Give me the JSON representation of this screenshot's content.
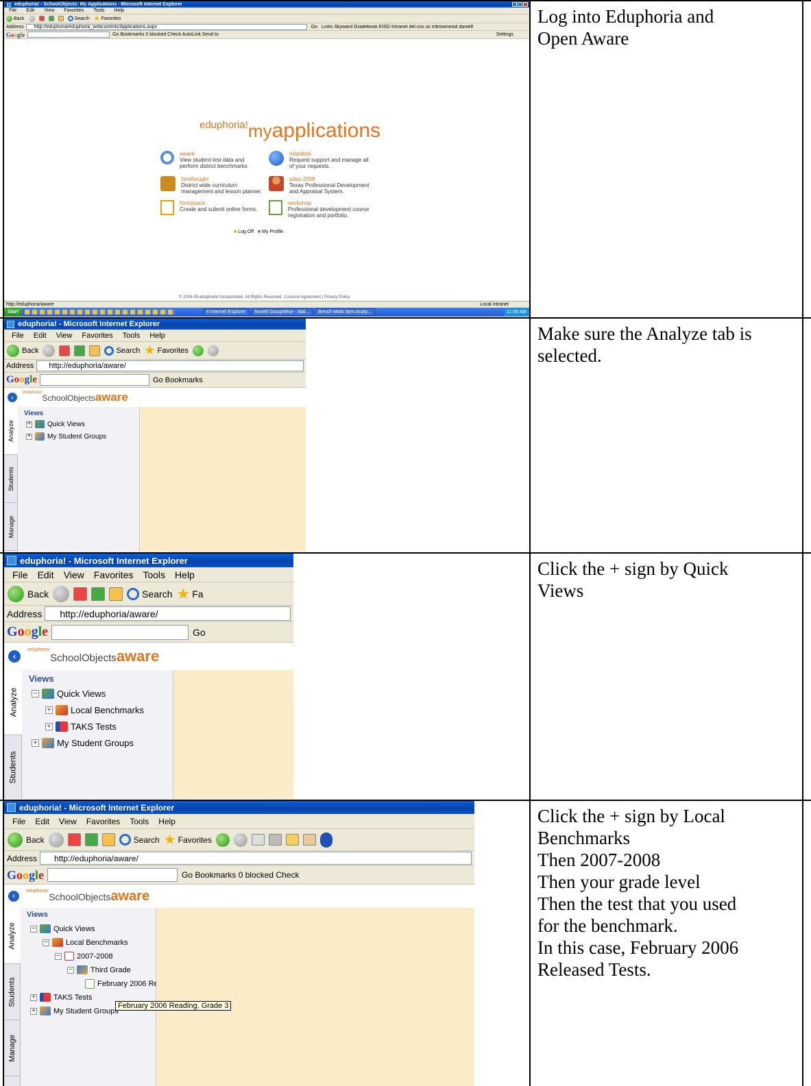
{
  "rows": [
    {
      "instruction_lines": [
        "Log into Eduphoria and",
        "Open Aware"
      ],
      "browser": {
        "title": "eduphoria! - SchoolObjects: My Applications - Microsoft Internet Explorer",
        "menu": [
          "File",
          "Edit",
          "View",
          "Favorites",
          "Tools",
          "Help"
        ],
        "back_label": "Back",
        "search_label": "Search",
        "favorites_label": "Favorites",
        "address_label": "Address",
        "address_value": "http://eduphoria/eduphoria_webcontrols/Applications.aspx",
        "go_label": "Go",
        "links_text": "Links  Skyward Gradebook  EISD Intranet  del.icio.us  mbrowneisd  danielf",
        "google_bar_text": "Go  Bookmarks  0 blocked  Check  AutoLink  Send to",
        "settings_label": "Settings"
      },
      "myapps": {
        "brand_small": "eduphoria!",
        "brand_my": "my",
        "brand_apps": "applications",
        "items": [
          {
            "name": "aware",
            "desc": "View student test data and perform district benchmarks"
          },
          {
            "name": "helpdesk",
            "desc": "Request support and manage all of your requests."
          },
          {
            "name": "forethought",
            "desc": "District wide curriculum management and lesson planner."
          },
          {
            "name": "pdas 2008",
            "desc": "Texas Professional Development and Appraisal System."
          },
          {
            "name": "formspace",
            "desc": "Create and submit online forms."
          },
          {
            "name": "workshop",
            "desc": "Professional development course registration and portfolio."
          }
        ],
        "logoff": "Log Off",
        "profile": "My Profile",
        "copyright": "© 2004-05 eduphoria! Incorporated. All Rights Reserved. | License Agreement | Privacy Policy"
      },
      "status_text": "http://eduphoria/aware",
      "status_zone": "Local intranet",
      "taskbar": {
        "start": "Start",
        "tasks": [
          "4 Internet Explorer",
          "Novell GroupWise - Mai...",
          "Bench Mark Item Analy..."
        ],
        "clock": "11:08 AM"
      }
    },
    {
      "instruction_lines": [
        "Make sure the Analyze tab is",
        "selected."
      ],
      "browser": {
        "title": "eduphoria! - Microsoft Internet Explorer",
        "menu": [
          "File",
          "Edit",
          "View",
          "Favorites",
          "Tools",
          "Help"
        ],
        "back_label": "Back",
        "search_label": "Search",
        "favorites_label": "Favorites",
        "address_label": "Address",
        "address_value": "http://eduphoria/aware/",
        "google_bar_text": "Go  Bookmarks"
      },
      "app": {
        "logo_small": "eduphoria!",
        "logo_so": "SchoolObjects",
        "logo_aw": "aware",
        "views": "Views",
        "tabs": [
          "Analyze",
          "Students",
          "Manage"
        ],
        "tree": [
          "Quick Views",
          "My Student Groups"
        ]
      }
    },
    {
      "instruction_lines": [
        "Click the + sign by Quick",
        "Views"
      ],
      "browser": {
        "title": "eduphoria! - Microsoft Internet Explorer",
        "menu": [
          "File",
          "Edit",
          "View",
          "Favorites",
          "Tools",
          "Help"
        ],
        "back_label": "Back",
        "search_label": "Search",
        "favorites_label": "Fa",
        "address_label": "Address",
        "address_value": "http://eduphoria/aware/",
        "google_bar_text": "Go"
      },
      "app": {
        "logo_small": "eduphoria!",
        "logo_so": "SchoolObjects",
        "logo_aw": "aware",
        "views": "Views",
        "tabs": [
          "Analyze",
          "Students"
        ],
        "tree": [
          "Quick Views",
          "Local Benchmarks",
          "TAKS Tests",
          "My Student Groups"
        ]
      }
    },
    {
      "instruction_lines": [
        "Click the + sign by Local",
        "Benchmarks",
        "Then 2007-2008",
        "Then your grade level",
        "Then the test that you used",
        "for the benchmark.",
        "In this case, February 2006",
        "Released Tests."
      ],
      "browser": {
        "title": "eduphoria! - Microsoft Internet Explorer",
        "menu": [
          "File",
          "Edit",
          "View",
          "Favorites",
          "Tools",
          "Help"
        ],
        "back_label": "Back",
        "search_label": "Search",
        "favorites_label": "Favorites",
        "address_label": "Address",
        "address_value": "http://eduphoria/aware/",
        "google_bar_text": "Go  Bookmarks  0 blocked  Check"
      },
      "app": {
        "logo_small": "eduphoria!",
        "logo_so": "SchoolObjects",
        "logo_aw": "aware",
        "views": "Views",
        "tabs": [
          "Analyze",
          "Students",
          "Manage"
        ],
        "tree": [
          "Quick Views",
          "Local Benchmarks",
          "2007-2008",
          "Third Grade",
          "February 2006 Re",
          "TAKS Tests",
          "My Student Groups"
        ],
        "tooltip": "February 2006 Reading, Grade 3"
      }
    }
  ]
}
